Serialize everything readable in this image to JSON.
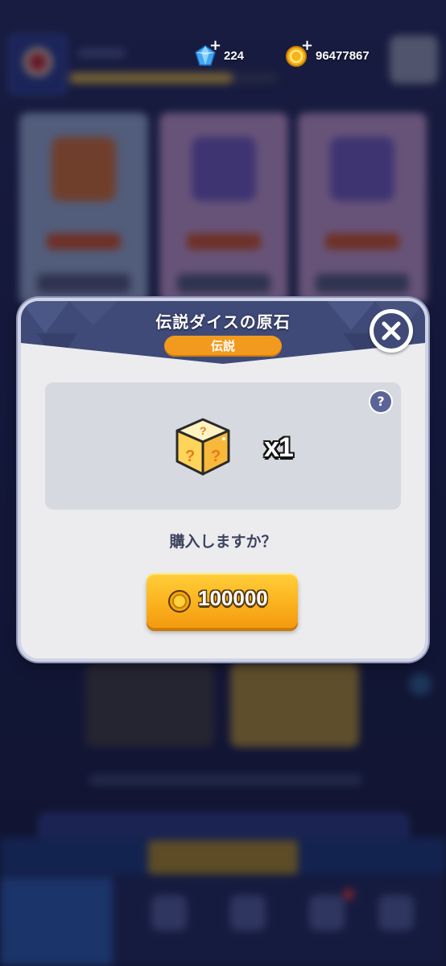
{
  "hud": {
    "gems": "224",
    "coins": "96477867"
  },
  "modal": {
    "title": "伝説ダイスの原石",
    "rarity": "伝説",
    "help_symbol": "?",
    "quantity": "x1",
    "confirm_text": "購入しますか？",
    "price": "100000"
  },
  "colors": {
    "header": "#3f4a78",
    "rarity_badge": "#f29a1e",
    "buy_button": "#fbb21e",
    "panel": "#d7d9e1"
  },
  "icons": [
    "gem-icon",
    "coin-icon",
    "plus-icon",
    "close-icon",
    "help-icon",
    "mystery-dice-icon"
  ]
}
